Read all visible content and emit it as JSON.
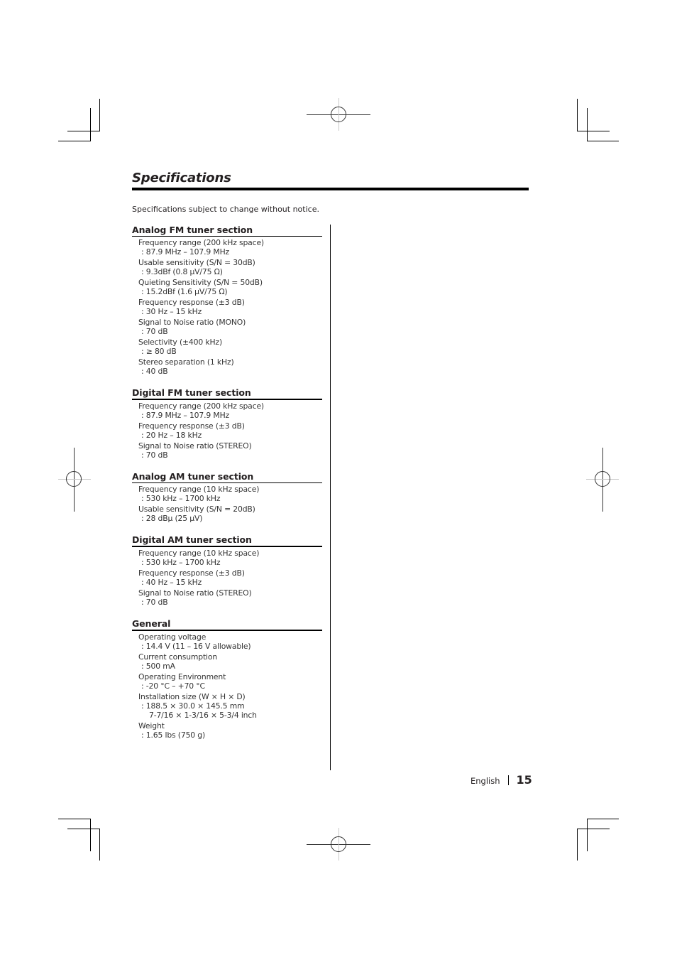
{
  "page": {
    "title": "Specifications",
    "intro": "Specifications subject to change without notice.",
    "footer_language": "English",
    "page_number": "15"
  },
  "sections": [
    {
      "title": "Analog FM tuner section",
      "items": [
        {
          "label": "Frequency range (200 kHz space)",
          "value": ": 87.9 MHz – 107.9 MHz"
        },
        {
          "label": "Usable sensitivity (S/N = 30dB)",
          "value": ": 9.3dBf (0.8 µV/75 Ω)"
        },
        {
          "label": "Quieting Sensitivity (S/N = 50dB)",
          "value": ": 15.2dBf (1.6 µV/75 Ω)"
        },
        {
          "label": "Frequency response (±3 dB)",
          "value": ": 30 Hz – 15 kHz"
        },
        {
          "label": "Signal to Noise ratio (MONO)",
          "value": ": 70 dB"
        },
        {
          "label": "Selectivity (±400 kHz)",
          "value": ": ≥ 80 dB"
        },
        {
          "label": "Stereo separation (1 kHz)",
          "value": ": 40 dB"
        }
      ]
    },
    {
      "title": "Digital FM tuner section",
      "items": [
        {
          "label": "Frequency range (200 kHz space)",
          "value": ": 87.9 MHz – 107.9 MHz"
        },
        {
          "label": "Frequency response (±3 dB)",
          "value": ": 20 Hz – 18 kHz"
        },
        {
          "label": "Signal to Noise ratio (STEREO)",
          "value": ": 70 dB"
        }
      ]
    },
    {
      "title": "Analog AM tuner section",
      "items": [
        {
          "label": "Frequency range (10 kHz space)",
          "value": ": 530 kHz – 1700 kHz"
        },
        {
          "label": "Usable sensitivity (S/N = 20dB)",
          "value": ": 28 dBµ (25 µV)"
        }
      ]
    },
    {
      "title": "Digital AM tuner section",
      "items": [
        {
          "label": "Frequency range (10 kHz space)",
          "value": ": 530 kHz – 1700 kHz"
        },
        {
          "label": "Frequency response (±3 dB)",
          "value": ": 40 Hz – 15 kHz"
        },
        {
          "label": "Signal to Noise ratio (STEREO)",
          "value": ": 70 dB"
        }
      ]
    },
    {
      "title": "General",
      "items": [
        {
          "label": "Operating voltage",
          "value": ": 14.4 V (11 – 16 V allowable)"
        },
        {
          "label": "Current consumption",
          "value": ": 500 mA"
        },
        {
          "label": "Operating Environment",
          "value": ": -20 °C – +70 °C"
        },
        {
          "label": "Installation size (W × H × D)",
          "value": ": 188.5 × 30.0 × 145.5 mm",
          "value2": "7-7/16 × 1-3/16 × 5-3/4 inch"
        },
        {
          "label": "Weight",
          "value": ": 1.65 lbs (750 g)"
        }
      ]
    }
  ]
}
